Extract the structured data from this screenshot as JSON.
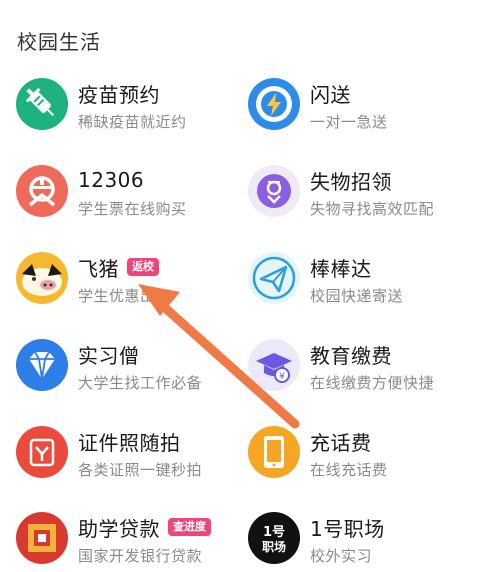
{
  "section": {
    "title": "校园生活"
  },
  "items": [
    {
      "title": "疫苗预约",
      "subtitle": "稀缺疫苗就近约",
      "icon": "vaccine-icon",
      "color": "#1db27e"
    },
    {
      "title": "闪送",
      "subtitle": "一对一急送",
      "icon": "lightning-icon",
      "color": "#2f8bea"
    },
    {
      "title": "12306",
      "subtitle": "学生票在线购买",
      "icon": "railway-icon",
      "color": "#ee6b5c"
    },
    {
      "title": "失物招领",
      "subtitle": "失物寻找高效匹配",
      "icon": "lost-found-icon",
      "color": "#8b5fe0"
    },
    {
      "title": "飞猪",
      "subtitle": "学生优惠出行",
      "icon": "fliggy-pig-icon",
      "color": "#f5b82e",
      "badge": "返校",
      "badge_color": "#f0457b"
    },
    {
      "title": "棒棒达",
      "subtitle": "校园快递寄送",
      "icon": "paper-plane-icon",
      "color": "#2c9ed9"
    },
    {
      "title": "实习僧",
      "subtitle": "大学生找工作必备",
      "icon": "diamond-icon",
      "color": "#2d7ee6"
    },
    {
      "title": "教育缴费",
      "subtitle": "在线缴费方便快捷",
      "icon": "graduation-cap-icon",
      "color": "#6a58e0"
    },
    {
      "title": "证件照随拍",
      "subtitle": "各类证照一键秒拍",
      "icon": "id-photo-icon",
      "color": "#ea4b3c"
    },
    {
      "title": "充话费",
      "subtitle": "在线充话费",
      "icon": "phone-recharge-icon",
      "color": "#f5a623"
    },
    {
      "title": "助学贷款",
      "subtitle": "国家开发银行贷款",
      "icon": "student-loan-icon",
      "color": "#d93a30",
      "badge": "查进度",
      "badge_color": "#f0457b"
    },
    {
      "title": "1号职场",
      "subtitle": "校外实习",
      "icon": "job-1-icon",
      "color": "#111111",
      "icon_text": "1号\n职场"
    }
  ],
  "colors": {
    "arrow": "#f07a45",
    "subtitle": "#8a8a8a"
  }
}
